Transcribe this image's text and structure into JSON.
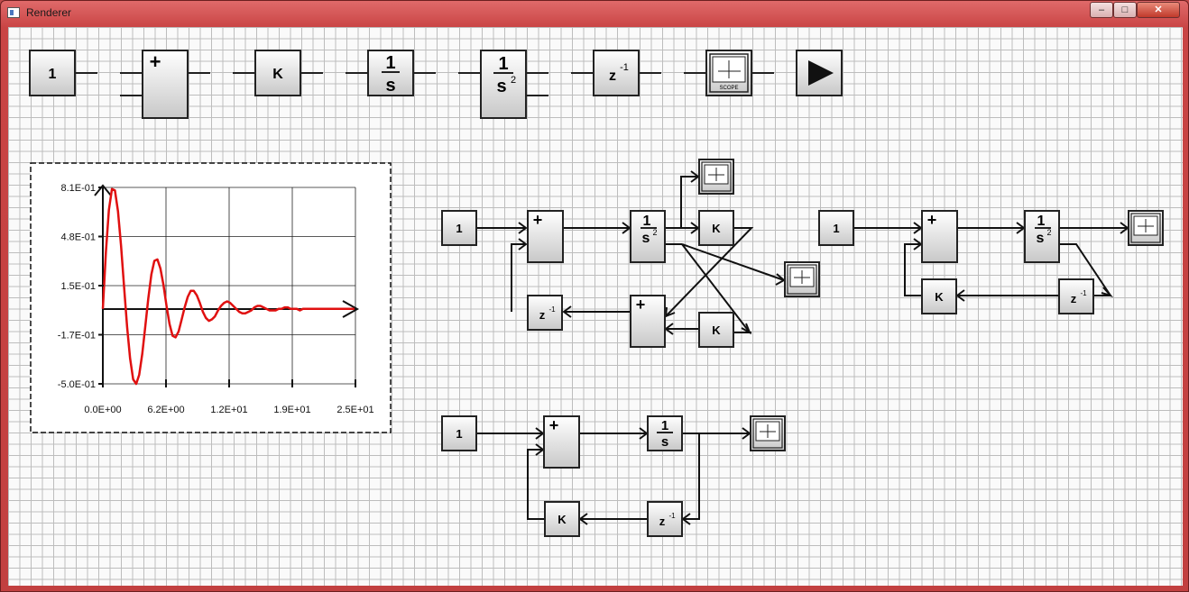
{
  "window": {
    "title": "Renderer",
    "minimize_glyph": "–",
    "maximize_glyph": "□",
    "close_glyph": "✕"
  },
  "palette": {
    "constant_label": "1",
    "gain_label": "K",
    "integrator_num": "1",
    "integrator_den": "s",
    "double_integrator_num": "1",
    "double_integrator_den": "s",
    "double_integrator_exp": "2",
    "delay_label": "z",
    "delay_exp": "-1",
    "sum_sign": "+",
    "scope_text": "SCOPE",
    "play_icon": "play-icon"
  },
  "chart_data": {
    "type": "line",
    "title": "",
    "xlabel": "",
    "ylabel": "",
    "xlim": [
      0,
      25
    ],
    "ylim": [
      -0.5,
      0.81
    ],
    "x_tick_labels": [
      "0.0E+00",
      "6.2E+00",
      "1.2E+01",
      "1.9E+01",
      "2.5E+01"
    ],
    "y_tick_labels": [
      "8.1E-01",
      "4.8E-01",
      "1.5E-01",
      "-1.7E-01",
      "-5.0E-01"
    ],
    "grid": true,
    "series": [
      {
        "color": "#e01010",
        "x": [
          0.0,
          0.3,
          0.6,
          0.9,
          1.2,
          1.5,
          1.8,
          2.1,
          2.4,
          2.7,
          3.0,
          3.3,
          3.6,
          3.9,
          4.2,
          4.5,
          4.8,
          5.1,
          5.4,
          5.7,
          6.0,
          6.3,
          6.6,
          6.9,
          7.2,
          7.5,
          7.8,
          8.1,
          8.4,
          8.7,
          9.0,
          9.3,
          9.6,
          9.9,
          10.2,
          10.5,
          10.8,
          11.1,
          11.4,
          11.7,
          12.0,
          12.3,
          12.6,
          12.9,
          13.2,
          13.5,
          13.8,
          14.1,
          14.4,
          14.7,
          15.0,
          15.3,
          15.6,
          15.9,
          16.2,
          16.5,
          16.8,
          17.1,
          17.4,
          17.7,
          18.0,
          18.3,
          18.6,
          18.9,
          19.2,
          19.5,
          19.8,
          20.1,
          20.4,
          20.7,
          21.0,
          21.3,
          21.6,
          21.9,
          22.2,
          22.5,
          22.8,
          23.1,
          23.4,
          23.7,
          24.0,
          24.3,
          24.6,
          24.9
        ],
        "y": [
          0.0,
          0.38,
          0.66,
          0.8,
          0.79,
          0.65,
          0.42,
          0.15,
          -0.12,
          -0.33,
          -0.47,
          -0.5,
          -0.44,
          -0.3,
          -0.12,
          0.07,
          0.23,
          0.32,
          0.33,
          0.27,
          0.16,
          0.02,
          -0.1,
          -0.18,
          -0.19,
          -0.15,
          -0.07,
          0.01,
          0.08,
          0.12,
          0.12,
          0.09,
          0.04,
          -0.02,
          -0.06,
          -0.08,
          -0.07,
          -0.05,
          -0.01,
          0.02,
          0.04,
          0.05,
          0.04,
          0.02,
          0.0,
          -0.02,
          -0.03,
          -0.03,
          -0.02,
          -0.01,
          0.01,
          0.02,
          0.02,
          0.01,
          0.0,
          -0.01,
          -0.01,
          -0.01,
          0.0,
          0.0,
          0.01,
          0.01,
          0.0,
          0.0,
          0.0,
          -0.01,
          0.0,
          0.0,
          0.0,
          0.0,
          0.0,
          0.0,
          0.0,
          0.0,
          0.0,
          0.0,
          0.0,
          0.0,
          0.0,
          0.0,
          0.0,
          0.0,
          0.0,
          0.0
        ]
      }
    ]
  }
}
